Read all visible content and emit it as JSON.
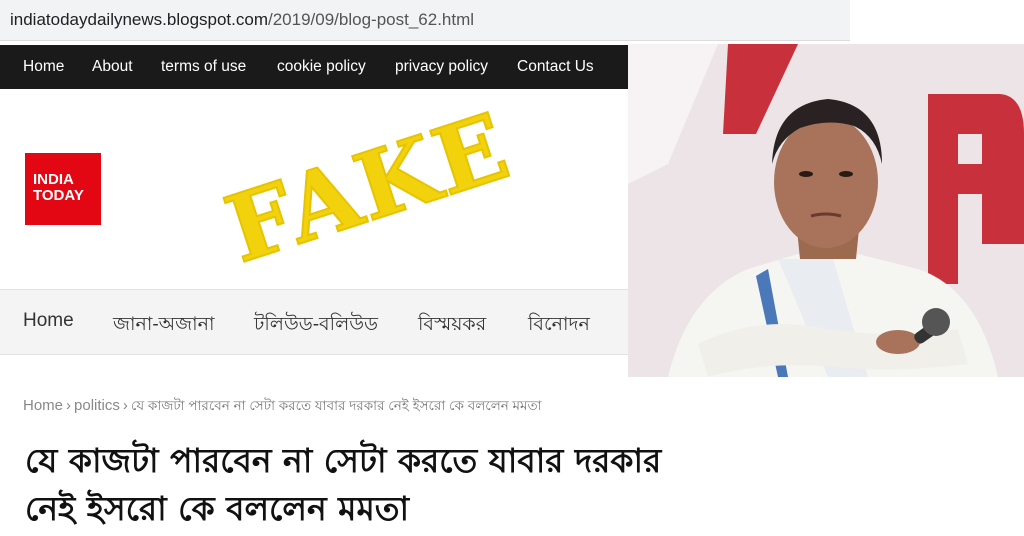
{
  "browser": {
    "url_host": "indiatodaydailynews.blogspot.com",
    "url_path": "/2019/09/blog-post_62.html"
  },
  "topnav": {
    "items": [
      "Home",
      "About",
      "terms of use",
      "cookie policy",
      "privacy policy",
      "Contact Us"
    ]
  },
  "header": {
    "logo_line1": "INDIA",
    "logo_line2": "TODAY",
    "stamp_text": "FAKE",
    "stamp_color": "#f2d20c"
  },
  "catnav": {
    "items": [
      "Home",
      "জানা-অজানা",
      "টলিউড-বলিউড",
      "বিস্ময়কর",
      "বিনোদন"
    ]
  },
  "breadcrumb": {
    "home": "Home",
    "section": "politics",
    "separator": "›",
    "current": "যে কাজটা পারবেন না সেটা করতে যাবার দরকার নেই ইসরো কে বললেন মমতা"
  },
  "article": {
    "headline_line1": "যে কাজটা পারবেন না সেটা করতে যাবার দরকার",
    "headline_line2": "নেই ইসরো কে বললেন মমতা"
  },
  "colors": {
    "topnav_bg": "#1a1a1a",
    "logo_red": "#e30613",
    "catnav_bg": "#f4f4f4"
  }
}
